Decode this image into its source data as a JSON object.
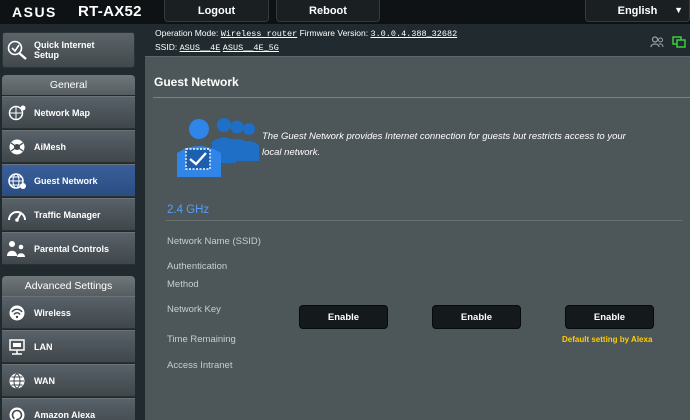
{
  "header": {
    "brand": "ASUS",
    "model": "RT-AX52",
    "logout_label": "Logout",
    "reboot_label": "Reboot",
    "language": "English"
  },
  "status": {
    "operation_mode_label": "Operation Mode:",
    "operation_mode_value": "Wireless router",
    "firmware_label": "Firmware Version:",
    "firmware_value": "3.0.0.4.388_32682",
    "ssid_label": "SSID:",
    "ssid_1": "ASUS__4E",
    "ssid_2": "ASUS__4E_5G",
    "icons": [
      "clients-icon",
      "network-status-icon"
    ]
  },
  "sidebar": {
    "quick_setup": {
      "label_1": "Quick Internet",
      "label_2": "Setup",
      "icon": "wand-icon"
    },
    "general_title": "General",
    "general_items": [
      {
        "label": "Network Map",
        "icon": "network-map-icon"
      },
      {
        "label": "AiMesh",
        "icon": "aimesh-icon"
      },
      {
        "label": "Guest Network",
        "icon": "globe-icon",
        "active": true
      },
      {
        "label": "Traffic Manager",
        "icon": "gauge-icon"
      },
      {
        "label": "Parental Controls",
        "icon": "family-icon"
      }
    ],
    "advanced_title": "Advanced Settings",
    "advanced_items": [
      {
        "label": "Wireless",
        "icon": "wifi-icon"
      },
      {
        "label": "LAN",
        "icon": "lan-icon"
      },
      {
        "label": "WAN",
        "icon": "wan-globe-icon"
      },
      {
        "label": "Amazon Alexa",
        "icon": "alexa-icon"
      }
    ]
  },
  "main": {
    "title": "Guest Network",
    "description": "The Guest Network provides Internet connection for guests but restricts access to your local network.",
    "band": "2.4 GHz",
    "fields": {
      "ssid": "Network Name (SSID)",
      "auth_1": "Authentication",
      "auth_2": "Method",
      "key": "Network Key",
      "time": "Time Remaining",
      "intranet": "Access Intranet"
    },
    "enable_buttons": [
      "Enable",
      "Enable",
      "Enable"
    ],
    "alexa_note": "Default setting by Alexa"
  },
  "colors": {
    "accent_blue": "#569ff7",
    "active_item": "#2a4d82",
    "note_yellow": "#ffcc00",
    "panel_bg": "#4d5659"
  }
}
